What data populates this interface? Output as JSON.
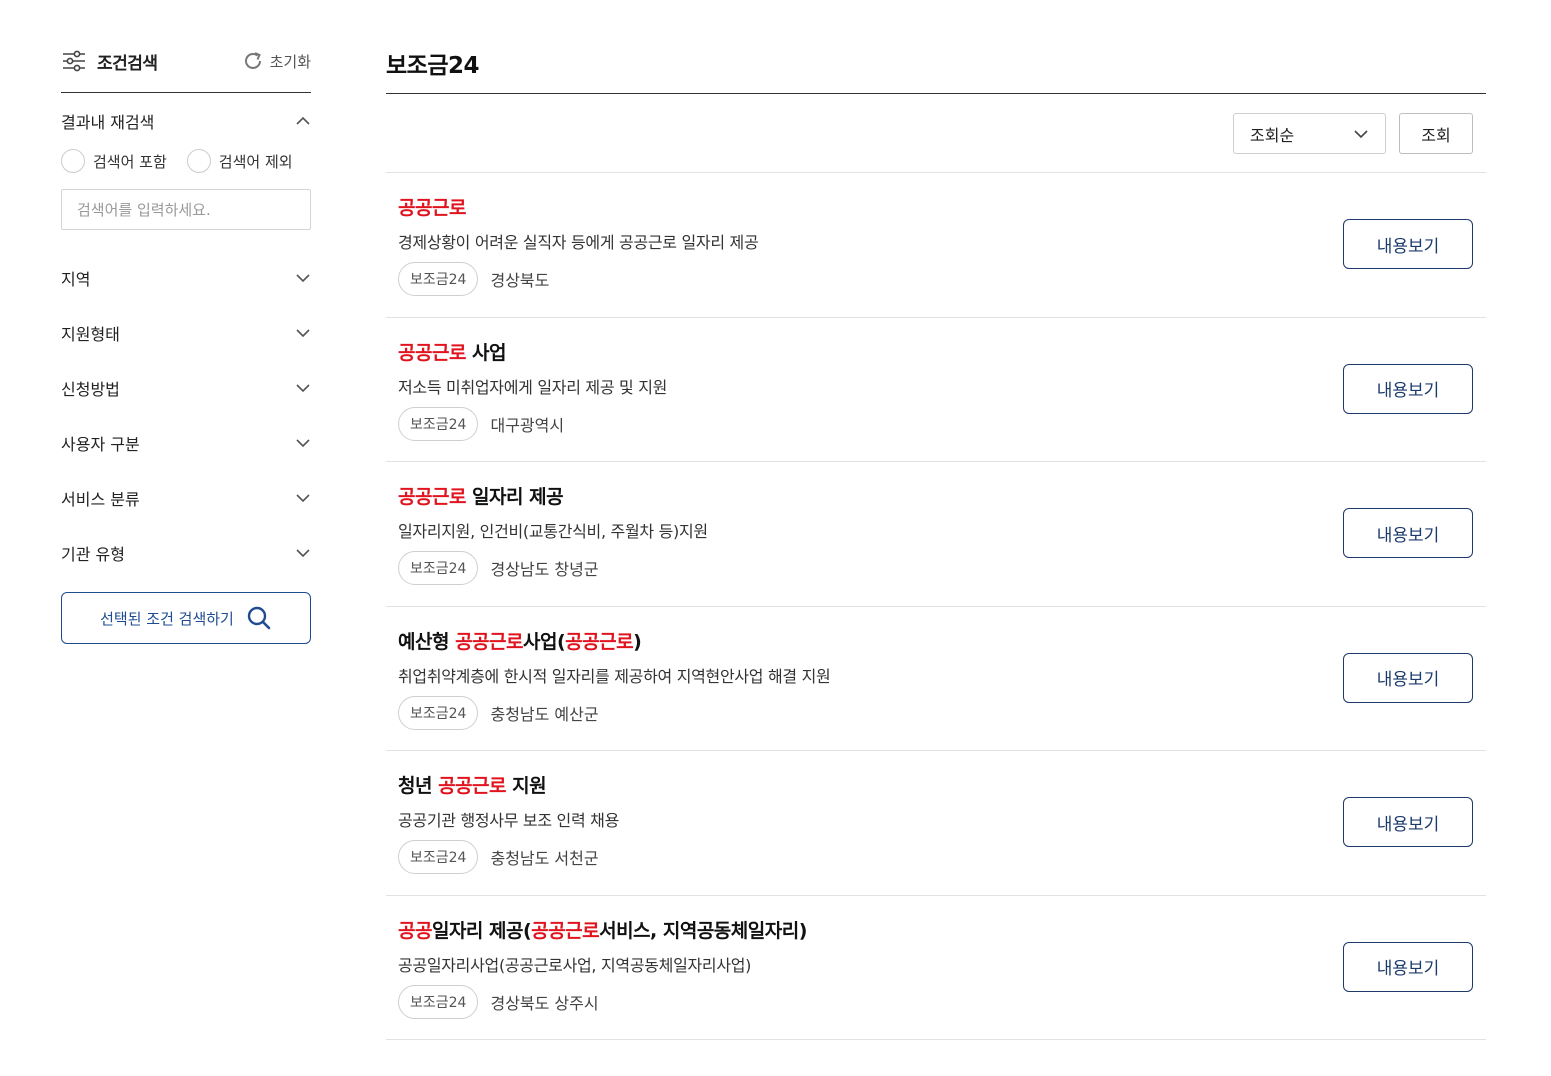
{
  "sidebar": {
    "title": "조건검색",
    "reset_label": "초기화",
    "re_search": {
      "label": "결과내 재검색",
      "radio_include": "검색어 포함",
      "radio_exclude": "검색어 제외",
      "placeholder": "검색어를 입력하세요."
    },
    "filters": [
      "지역",
      "지원형태",
      "신청방법",
      "사용자 구분",
      "서비스 분류",
      "기관 유형"
    ],
    "search_button": "선택된 조건 검색하기"
  },
  "main": {
    "title": "보조금24",
    "sort_selected": "조회순",
    "query_button": "조회",
    "view_label": "내용보기",
    "results": [
      {
        "title_parts": [
          {
            "text": "공공근로",
            "hl": true
          }
        ],
        "desc": "경제상황이 어려운 실직자 등에게 공공근로 일자리 제공",
        "tag": "보조금24",
        "region": "경상북도"
      },
      {
        "title_parts": [
          {
            "text": "공공근로",
            "hl": true
          },
          {
            "text": " 사업",
            "hl": false
          }
        ],
        "desc": "저소득 미취업자에게 일자리 제공 및 지원",
        "tag": "보조금24",
        "region": "대구광역시"
      },
      {
        "title_parts": [
          {
            "text": "공공근로",
            "hl": true
          },
          {
            "text": " 일자리 제공",
            "hl": false
          }
        ],
        "desc": "일자리지원, 인건비(교통간식비, 주월차 등)지원",
        "tag": "보조금24",
        "region": "경상남도 창녕군"
      },
      {
        "title_parts": [
          {
            "text": "예산형 ",
            "hl": false
          },
          {
            "text": "공공근로",
            "hl": true
          },
          {
            "text": "사업(",
            "hl": false
          },
          {
            "text": "공공근로",
            "hl": true
          },
          {
            "text": ")",
            "hl": false
          }
        ],
        "desc": "취업취약계층에 한시적 일자리를 제공하여 지역현안사업 해결 지원",
        "tag": "보조금24",
        "region": "충청남도 예산군"
      },
      {
        "title_parts": [
          {
            "text": "청년 ",
            "hl": false
          },
          {
            "text": "공공근로",
            "hl": true
          },
          {
            "text": " 지원",
            "hl": false
          }
        ],
        "desc": "공공기관 행정사무 보조 인력 채용",
        "tag": "보조금24",
        "region": "충청남도 서천군"
      },
      {
        "title_parts": [
          {
            "text": "공공",
            "hl": true
          },
          {
            "text": "일자리 제공(",
            "hl": false
          },
          {
            "text": "공공근로",
            "hl": true
          },
          {
            "text": "서비스, 지역공동체일자리)",
            "hl": false
          }
        ],
        "desc": "공공일자리사업(공공근로사업, 지역공동체일자리사업)",
        "tag": "보조금24",
        "region": "경상북도 상주시"
      }
    ]
  },
  "colors": {
    "highlight": "#e0141e",
    "primary_button": "#1c3a6b",
    "search_button": "#1f4c91"
  }
}
